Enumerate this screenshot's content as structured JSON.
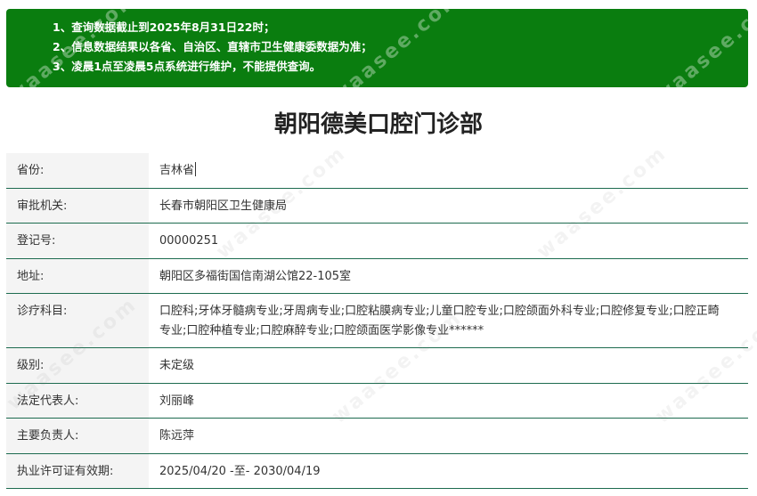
{
  "notice": {
    "lines": [
      "1、查询数据截止到2025年8月31日22时；",
      "2、信息数据结果以各省、自治区、直辖市卫生健康委数据为准；",
      "3、凌晨1点至凌晨5点系统进行维护，不能提供查询。"
    ]
  },
  "title": "朝阳德美口腔门诊部",
  "fields": [
    {
      "label": "省份:",
      "value": "吉林省"
    },
    {
      "label": "审批机关:",
      "value": "长春市朝阳区卫生健康局"
    },
    {
      "label": "登记号:",
      "value": "00000251"
    },
    {
      "label": "地址:",
      "value": "朝阳区多福街国信南湖公馆22-105室"
    },
    {
      "label": "诊疗科目:",
      "value": "口腔科;牙体牙髓病专业;牙周病专业;口腔粘膜病专业;儿童口腔专业;口腔颌面外科专业;口腔修复专业;口腔正畸专业;口腔种植专业;口腔麻醉专业;口腔颌面医学影像专业******"
    },
    {
      "label": "级别:",
      "value": "未定级"
    },
    {
      "label": "法定代表人:",
      "value": "刘丽峰"
    },
    {
      "label": "主要负责人:",
      "value": "陈远萍"
    },
    {
      "label": "执业许可证有效期:",
      "value": "2025/04/20 -至- 2030/04/19"
    }
  ],
  "watermark": "waasee.com"
}
